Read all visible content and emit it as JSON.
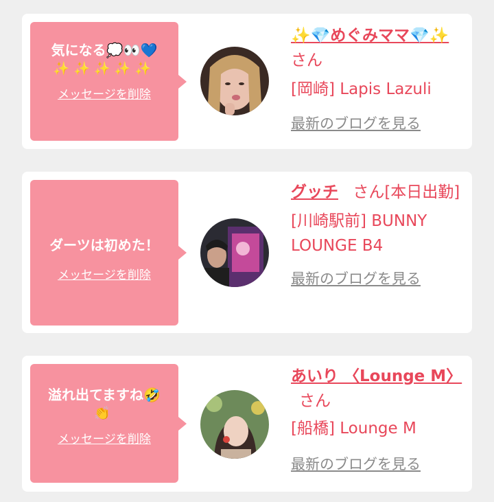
{
  "cards": [
    {
      "message": "気になる💭👀💙",
      "message_extra": "✨✨✨✨✨",
      "delete_label": "メッセージを削除",
      "name": "✨💎めぐみママ💎✨",
      "san": "さん",
      "shop": "[岡崎] Lapis Lazuli",
      "blog_label": "最新のブログを見る"
    },
    {
      "message": "ダーツは初めた！",
      "delete_label": "メッセージを削除",
      "name": "グッチ",
      "san": "さん[本日出勤]",
      "shop": "[川崎駅前] BUNNY LOUNGE B4",
      "blog_label": "最新のブログを見る"
    },
    {
      "message": "溢れ出てますね🤣",
      "message_extra": "👏",
      "delete_label": "メッセージを削除",
      "name": "あいり 〈Lounge M〉",
      "san": "さん",
      "shop": "[船橋] Lounge M",
      "blog_label": "最新のブログを見る"
    }
  ]
}
